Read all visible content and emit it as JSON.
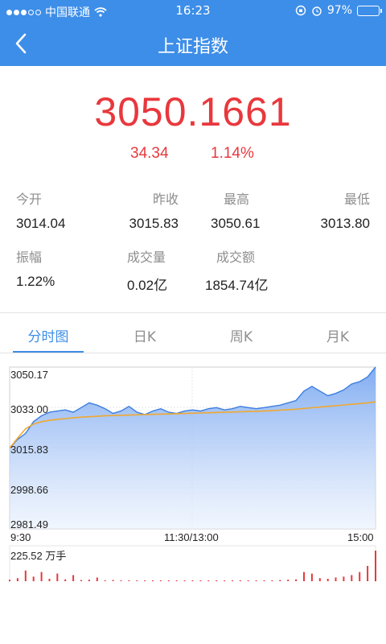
{
  "status_bar": {
    "carrier": "中国联通",
    "time": "16:23",
    "battery": "97%",
    "battery_level": 0.97
  },
  "nav": {
    "title": "上证指数"
  },
  "quote": {
    "price": "3050.1661",
    "change": "34.34",
    "change_pct": "1.14%"
  },
  "stats": {
    "open_label": "今开",
    "open_value": "3014.04",
    "prev_close_label": "昨收",
    "prev_close_value": "3015.83",
    "high_label": "最高",
    "high_value": "3050.61",
    "low_label": "最低",
    "low_value": "3013.80",
    "amplitude_label": "振幅",
    "amplitude_value": "1.22%",
    "volume_label": "成交量",
    "volume_value": "0.02亿",
    "turnover_label": "成交额",
    "turnover_value": "1854.74亿"
  },
  "tabs": [
    "分时图",
    "日K",
    "周K",
    "月K"
  ],
  "active_tab": 0,
  "colors": {
    "accent": "#3d8ee8",
    "up": "#e8383d",
    "avg_line": "#f0a830",
    "area_fill_top": "#7aa8f0"
  },
  "chart_data": {
    "type": "area",
    "y_ticks": [
      "3050.17",
      "3033.00",
      "3015.83",
      "2998.66",
      "2981.49"
    ],
    "ylim": [
      2981.49,
      3050.17
    ],
    "x_ticks": [
      "9:30",
      "11:30/13:00",
      "15:00"
    ],
    "volume_label": "225.52 万手",
    "series": [
      {
        "values": [
          3015.83,
          3019.5,
          3022.0,
          3027.0,
          3029.5,
          3031.0,
          3031.5,
          3032.0,
          3031.0,
          3033.0,
          3035.0,
          3034.0,
          3032.5,
          3030.5,
          3031.5,
          3033.5,
          3031.0,
          3030.0,
          3031.5,
          3032.5,
          3031.0,
          3030.5,
          3031.5,
          3032.0,
          3031.5,
          3032.5,
          3033.0,
          3032.0,
          3032.5,
          3033.5,
          3033.0,
          3032.5,
          3033.0,
          3033.5,
          3034.0,
          3035.0,
          3036.0,
          3040.0,
          3042.0,
          3040.0,
          3038.0,
          3039.0,
          3040.5,
          3043.0,
          3044.0,
          3046.0,
          3050.17
        ]
      },
      {
        "values": [
          3015.83,
          3020.0,
          3024.0,
          3026.0,
          3027.0,
          3027.6,
          3028.0,
          3028.3,
          3028.6,
          3028.9,
          3029.1,
          3029.3,
          3029.5,
          3029.6,
          3029.7,
          3029.8,
          3029.9,
          3030.0,
          3030.1,
          3030.2,
          3030.3,
          3030.4,
          3030.5,
          3030.6,
          3030.7,
          3030.8,
          3030.9,
          3031.0,
          3031.1,
          3031.2,
          3031.3,
          3031.4,
          3031.5,
          3031.7,
          3031.9,
          3032.1,
          3032.3,
          3032.6,
          3032.9,
          3033.2,
          3033.5,
          3033.8,
          3034.1,
          3034.4,
          3034.7,
          3035.0,
          3035.4
        ]
      }
    ],
    "volume": [
      0.05,
      0.1,
      0.35,
      0.15,
      0.3,
      0.08,
      0.25,
      0.06,
      0.2,
      0.04,
      0.05,
      0.12,
      0.03,
      0.04,
      0.02,
      0.03,
      0.02,
      0.03,
      0.02,
      0.02,
      0.03,
      0.02,
      0.02,
      0.03,
      0.02,
      0.02,
      0.03,
      0.02,
      0.02,
      0.03,
      0.02,
      0.02,
      0.03,
      0.03,
      0.04,
      0.05,
      0.06,
      0.3,
      0.25,
      0.1,
      0.08,
      0.12,
      0.15,
      0.2,
      0.3,
      0.5,
      1.0
    ]
  }
}
